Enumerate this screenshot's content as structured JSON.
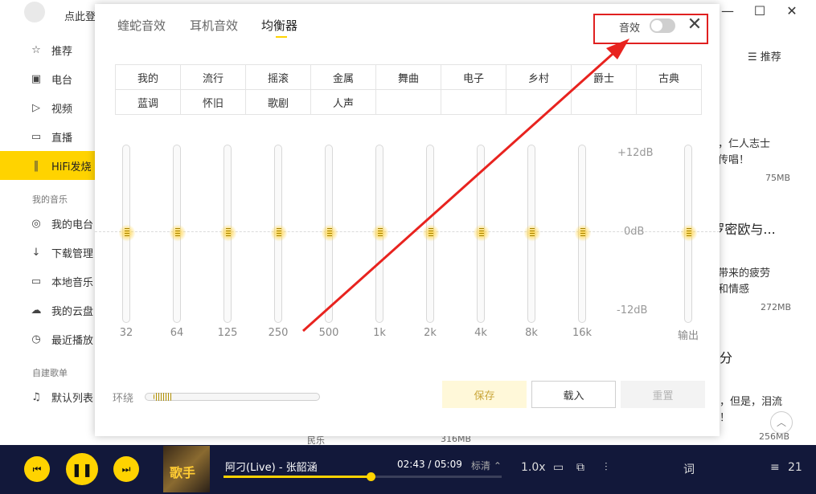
{
  "window": {
    "minimize": "—",
    "maximize": "☐",
    "close": "✕"
  },
  "sidebar": {
    "login": "点此登",
    "items": [
      {
        "label": "推荐",
        "icon": "star-icon"
      },
      {
        "label": "电台",
        "icon": "radio-icon"
      },
      {
        "label": "视频",
        "icon": "video-icon"
      },
      {
        "label": "直播",
        "icon": "live-icon"
      },
      {
        "label": "HiFi发烧",
        "icon": "hifi-icon"
      }
    ],
    "section_my_music": "我的音乐",
    "my_items": [
      {
        "label": "我的电台",
        "icon": "my-radio-icon"
      },
      {
        "label": "下载管理",
        "icon": "download-icon"
      },
      {
        "label": "本地音乐",
        "icon": "monitor-icon"
      },
      {
        "label": "我的云盘",
        "icon": "cloud-icon"
      },
      {
        "label": "最近播放",
        "icon": "clock-icon"
      }
    ],
    "section_playlists": "自建歌单",
    "playlist_items": [
      {
        "label": "默认列表",
        "icon": "list-icon"
      }
    ]
  },
  "background": {
    "recommend": "推荐",
    "line1": "炎，仁人志士",
    "line2": "代传唱！",
    "size1": "75MB",
    "title2": ":罗密欧与...",
    "line3": "活带来的疲劳",
    "line4": "松和情感",
    "size2": "272MB",
    "title3": "分",
    "line5": "，但是，泪流",
    "line6": "！",
    "size3": "256MB",
    "bottom_label": "民乐",
    "bottom_size": "316MB"
  },
  "eq": {
    "tabs": [
      "蝰蛇音效",
      "耳机音效",
      "均衡器"
    ],
    "active_tab": "均衡器",
    "sound_effect_label": "音效",
    "sound_effect_on": false,
    "presets": [
      "我的",
      "流行",
      "摇滚",
      "金属",
      "舞曲",
      "电子",
      "乡村",
      "爵士",
      "古典",
      "蓝调",
      "怀旧",
      "歌剧",
      "人声",
      "",
      "",
      "",
      "",
      ""
    ],
    "frequencies": [
      "32",
      "64",
      "125",
      "250",
      "500",
      "1k",
      "2k",
      "4k",
      "8k",
      "16k"
    ],
    "gains_db": [
      0,
      0,
      0,
      0,
      0,
      0,
      0,
      0,
      0,
      0
    ],
    "output_label": "输出",
    "output_db": 0,
    "db_top": "+12dB",
    "db_mid": "0dB",
    "db_bottom": "-12dB",
    "surround_label": "环绕",
    "save": "保存",
    "load": "载入",
    "reset": "重置"
  },
  "player": {
    "cover_text": "歌手",
    "song": "阿刁(Live) - 张韶涵",
    "time": "02:43 / 05:09",
    "quality": "标清 ⌃",
    "progress": 0.53,
    "speed": "1.0x",
    "count": "21"
  }
}
